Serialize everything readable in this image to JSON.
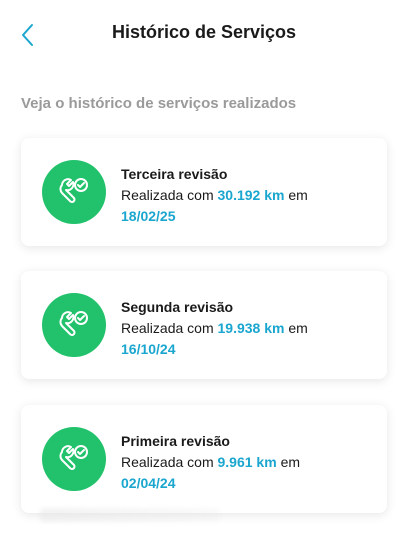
{
  "header": {
    "title": "Histórico de Serviços"
  },
  "subtitle": "Veja o histórico de serviços realizados",
  "colors": {
    "accent": "#1aa6cf",
    "icon_bg": "#21c26b"
  },
  "services": [
    {
      "title": "Terceira revisão",
      "prefix": "Realizada com",
      "km": "30.192 km",
      "suffix": "em",
      "date": "18/02/25",
      "icon": "wrench-check-icon"
    },
    {
      "title": "Segunda revisão",
      "prefix": "Realizada com",
      "km": "19.938 km",
      "suffix": "em",
      "date": "16/10/24",
      "icon": "wrench-check-icon"
    },
    {
      "title": "Primeira revisão",
      "prefix": "Realizada com",
      "km": "9.961 km",
      "suffix": "em",
      "date": "02/04/24",
      "icon": "wrench-check-icon"
    }
  ]
}
